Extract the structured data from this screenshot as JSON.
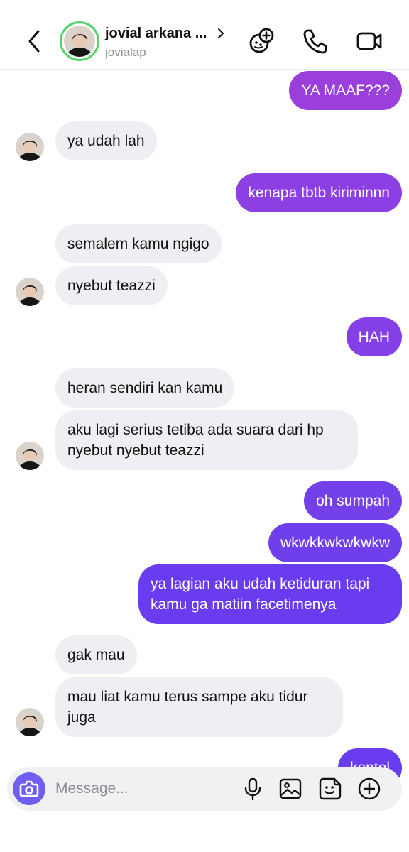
{
  "header": {
    "name": "jovial arkana ...",
    "username": "jovialap"
  },
  "messages": [
    {
      "text": "YA MAAF???"
    },
    {
      "text": "ya udah lah"
    },
    {
      "text": "kenapa tbtb kiriminnn"
    },
    {
      "text": "semalem kamu ngigo"
    },
    {
      "text": "nyebut teazzi"
    },
    {
      "text": "HAH"
    },
    {
      "text": "heran sendiri kan kamu"
    },
    {
      "text": "aku lagi serius tetiba ada suara dari hp nyebut nyebut teazzi"
    },
    {
      "text": "oh sumpah"
    },
    {
      "text": "wkwkkwkwkwkw"
    },
    {
      "text": "ya lagian aku udah ketiduran tapi kamu ga matiin facetimenya"
    },
    {
      "text": "gak mau"
    },
    {
      "text": "mau liat kamu terus sampe aku tidur juga"
    },
    {
      "text": "kontol"
    }
  ],
  "composer": {
    "placeholder": "Message..."
  },
  "colors": {
    "sent_purple_light": "#9d3fdc",
    "sent_purple_mid": "#7e3fe8",
    "sent_purple_deep": "#6a3cf0",
    "received_bg": "#efeff3",
    "online_ring": "#4fd36a",
    "camera_button": "#6e5ff0"
  },
  "icons": {
    "back": "chevron-left-icon",
    "effects": "sticker-plus-icon",
    "call": "phone-icon",
    "video": "video-camera-icon",
    "camera": "camera-icon",
    "mic": "microphone-icon",
    "gallery": "image-icon",
    "sticker": "sticker-icon",
    "more": "plus-circle-icon"
  }
}
